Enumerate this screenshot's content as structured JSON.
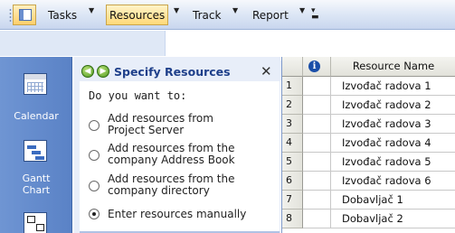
{
  "toolbar": {
    "tasks_label": "Tasks",
    "resources_label": "Resources",
    "track_label": "Track",
    "report_label": "Report"
  },
  "viewbar": {
    "items": [
      {
        "label": "Calendar",
        "icon": "calendar-icon"
      },
      {
        "label": "Gantt\nChart",
        "icon": "gantt-chart-icon"
      },
      {
        "label": "",
        "icon": "network-diagram-icon"
      }
    ]
  },
  "pane": {
    "title": "Specify Resources",
    "question": "Do you want to:",
    "options": [
      {
        "line1": "Add resources from",
        "line2": "Project Server",
        "selected": false
      },
      {
        "line1": "Add resources from the",
        "line2": "company Address Book",
        "selected": false
      },
      {
        "line1": "Add resources from the",
        "line2": "company directory",
        "selected": false
      },
      {
        "line1": "Enter resources manually",
        "line2": "",
        "selected": true
      }
    ]
  },
  "grid": {
    "indicator_header_icon": "info-icon",
    "name_header": "Resource Name",
    "rows": [
      {
        "num": "1",
        "name": "Izvođač radova 1"
      },
      {
        "num": "2",
        "name": "Izvođač radova 2"
      },
      {
        "num": "3",
        "name": "Izvođač radova 3"
      },
      {
        "num": "4",
        "name": "Izvođač radova 4"
      },
      {
        "num": "5",
        "name": "Izvođač radova 5"
      },
      {
        "num": "6",
        "name": "Izvođač radova 6"
      },
      {
        "num": "7",
        "name": "Dobavljač 1"
      },
      {
        "num": "8",
        "name": "Dobavljač 2"
      }
    ]
  }
}
